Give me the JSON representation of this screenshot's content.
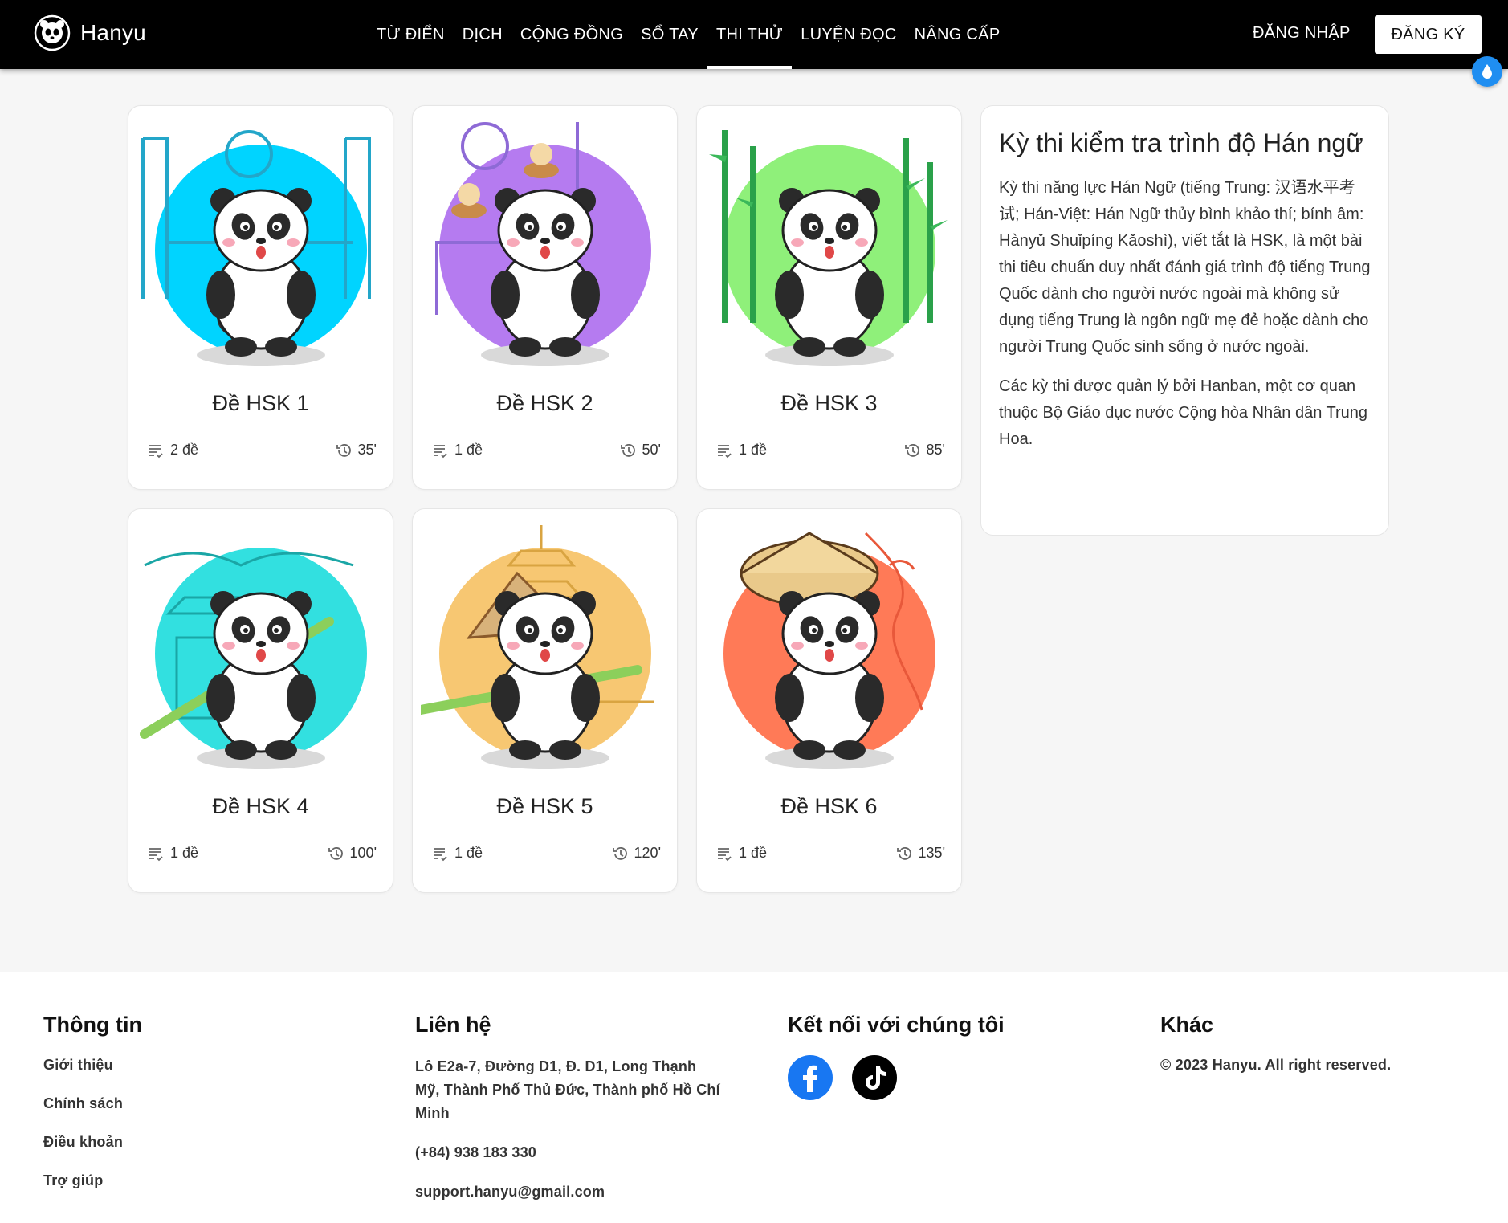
{
  "brand": {
    "name": "Hanyu"
  },
  "nav": {
    "items": [
      {
        "label": "TỪ ĐIỂN"
      },
      {
        "label": "DỊCH"
      },
      {
        "label": "CỘNG ĐỒNG"
      },
      {
        "label": "SỔ TAY"
      },
      {
        "label": "THI THỬ",
        "active": true
      },
      {
        "label": "LUYỆN ĐỌC"
      },
      {
        "label": "NÂNG CẤP"
      }
    ],
    "login_label": "ĐĂNG NHẬP",
    "signup_label": "ĐĂNG KÝ"
  },
  "cards": [
    {
      "title": "Đề HSK 1",
      "count": "2 đề",
      "duration": "35'",
      "bg_color": "#00d4ff",
      "theme": "noodles"
    },
    {
      "title": "Đề HSK 2",
      "count": "1 đề",
      "duration": "50'",
      "bg_color": "#b57bf0",
      "theme": "dumplings"
    },
    {
      "title": "Đề HSK 3",
      "count": "1 đề",
      "duration": "85'",
      "bg_color": "#8ff07a",
      "theme": "bamboo"
    },
    {
      "title": "Đề HSK 4",
      "count": "1 đề",
      "duration": "100'",
      "bg_color": "#32e0e0",
      "theme": "temple"
    },
    {
      "title": "Đề HSK 5",
      "count": "1 đề",
      "duration": "120'",
      "bg_color": "#f7c772",
      "theme": "pagoda"
    },
    {
      "title": "Đề HSK 6",
      "count": "1 đề",
      "duration": "135'",
      "bg_color": "#ff7a57",
      "theme": "dragon"
    }
  ],
  "info": {
    "title": "Kỳ thi kiểm tra trình độ Hán ngữ",
    "p1": "Kỳ thi năng lực Hán Ngữ (tiếng Trung: 汉语水平考试; Hán-Việt: Hán Ngữ thủy bình khảo thí; bính âm: Hànyǔ Shuǐpíng Kǎoshì), viết tắt là HSK, là một bài thi tiêu chuẩn duy nhất đánh giá trình độ tiếng Trung Quốc dành cho người nước ngoài mà không sử dụng tiếng Trung là ngôn ngữ mẹ đẻ hoặc dành cho người Trung Quốc sinh sống ở nước ngoài.",
    "p2": "Các kỳ thi được quản lý bởi Hanban, một cơ quan thuộc Bộ Giáo dục nước Cộng hòa Nhân dân Trung Hoa."
  },
  "footer": {
    "info": {
      "heading": "Thông tin",
      "links": [
        "Giới thiệu",
        "Chính sách",
        "Điều khoản",
        "Trợ giúp"
      ]
    },
    "contact": {
      "heading": "Liên hệ",
      "address": "Lô E2a-7, Đường D1, Đ. D1, Long Thạnh Mỹ, Thành Phố Thủ Đức, Thành phố Hồ Chí Minh",
      "phone": "(+84) 938 183 330",
      "email": "support.hanyu@gmail.com"
    },
    "connect": {
      "heading": "Kết nối với chúng tôi",
      "icons": [
        "facebook-icon",
        "tiktok-icon"
      ]
    },
    "other": {
      "heading": "Khác",
      "copyright": "© 2023 Hanyu. All right reserved."
    }
  },
  "colors": {
    "header_bg": "#000000",
    "page_bg": "#f6f6f6",
    "drop_button": "#1f8ef1",
    "facebook": "#1877f2"
  }
}
